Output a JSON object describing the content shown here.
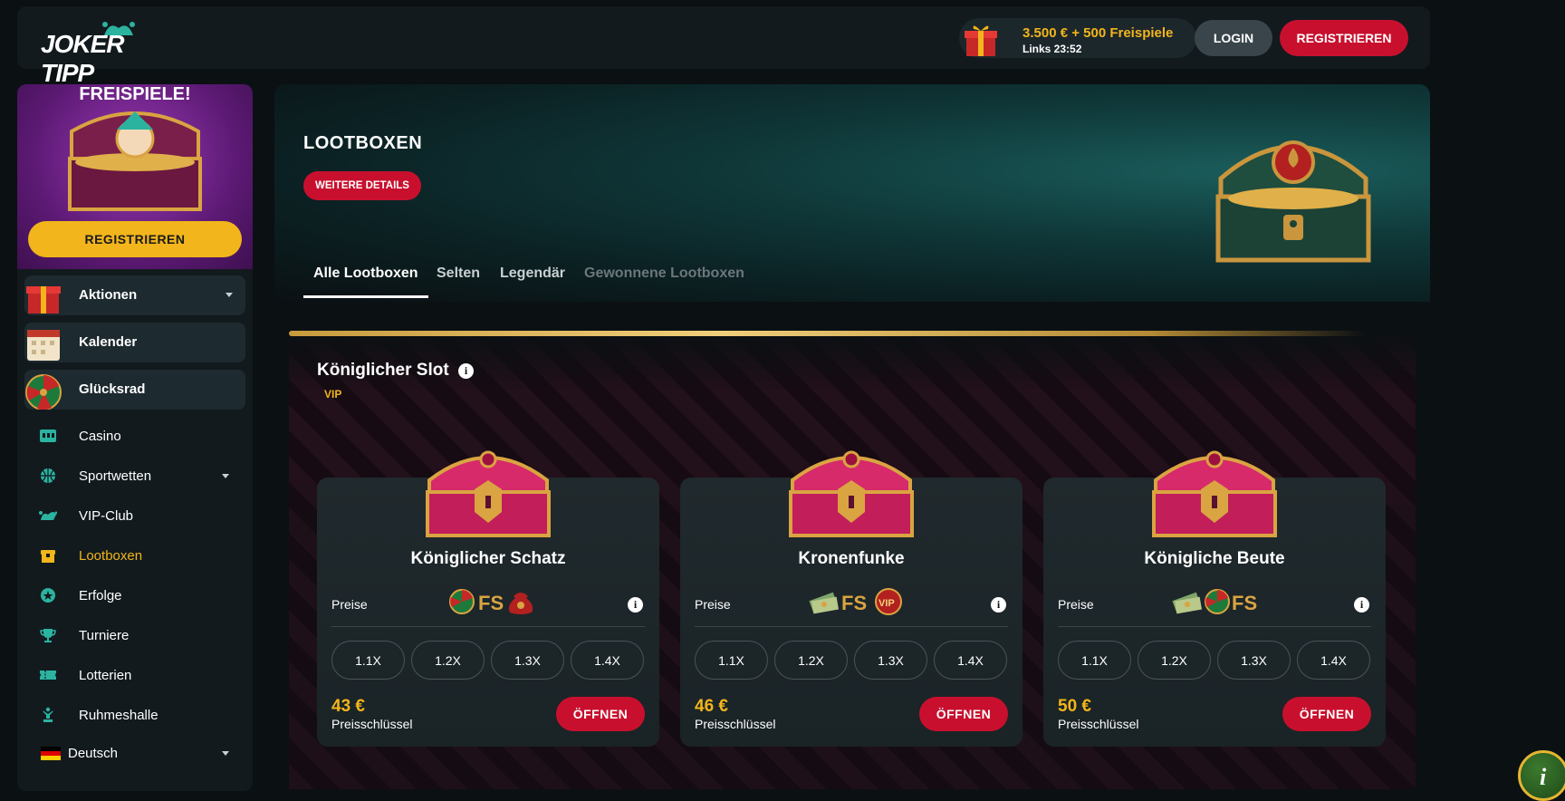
{
  "header": {
    "logo_text": "JOKER TIPP",
    "bonus_title": "3.500 € + 500 Freispiele",
    "bonus_timer": "Links 23:52",
    "login_label": "LOGIN",
    "register_label": "REGISTRIEREN"
  },
  "sidebar": {
    "promo_title": "FREISPIELE!",
    "promo_button": "REGISTRIEREN",
    "featured": [
      {
        "label": "Aktionen",
        "icon": "gift-icon"
      },
      {
        "label": "Kalender",
        "icon": "calendar-icon"
      },
      {
        "label": "Glücksrad",
        "icon": "wheel-icon"
      }
    ],
    "items": [
      {
        "label": "Casino",
        "icon": "slot-machine-icon"
      },
      {
        "label": "Sportwetten",
        "icon": "basketball-icon"
      },
      {
        "label": "VIP-Club",
        "icon": "jester-hat-icon"
      },
      {
        "label": "Lootboxen",
        "icon": "lootbox-icon"
      },
      {
        "label": "Erfolge",
        "icon": "star-badge-icon"
      },
      {
        "label": "Turniere",
        "icon": "trophy-icon"
      },
      {
        "label": "Lotterien",
        "icon": "ticket-icon"
      },
      {
        "label": "Ruhmeshalle",
        "icon": "statue-icon"
      }
    ],
    "language": "Deutsch"
  },
  "hero": {
    "title": "LOOTBOXEN",
    "details_button": "WEITERE DETAILS"
  },
  "tabs": [
    {
      "label": "Alle Lootboxen",
      "state": "active"
    },
    {
      "label": "Selten",
      "state": "normal"
    },
    {
      "label": "Legendär",
      "state": "normal"
    },
    {
      "label": "Gewonnene Lootboxen",
      "state": "disabled"
    }
  ],
  "section": {
    "title": "Königlicher Slot",
    "tag": "VIP"
  },
  "cards": [
    {
      "title": "Königlicher Schatz",
      "preise_label": "Preise",
      "prize_icons": [
        "wheel-icon",
        "fs-icon",
        "sack-icon"
      ],
      "multipliers": [
        "1.1X",
        "1.2X",
        "1.3X",
        "1.4X"
      ],
      "price": "43 €",
      "price_label": "Preisschlüssel",
      "open_label": "ÖFFNEN"
    },
    {
      "title": "Kronenfunke",
      "preise_label": "Preise",
      "prize_icons": [
        "cash-icon",
        "fs-icon",
        "vip-icon"
      ],
      "multipliers": [
        "1.1X",
        "1.2X",
        "1.3X",
        "1.4X"
      ],
      "price": "46 €",
      "price_label": "Preisschlüssel",
      "open_label": "ÖFFNEN"
    },
    {
      "title": "Königliche Beute",
      "preise_label": "Preise",
      "prize_icons": [
        "cash-icon",
        "wheel-icon",
        "fs-icon"
      ],
      "multipliers": [
        "1.1X",
        "1.2X",
        "1.3X",
        "1.4X"
      ],
      "price": "50 €",
      "price_label": "Preisschlüssel",
      "open_label": "ÖFFNEN"
    }
  ],
  "colors": {
    "accent_gold": "#f2b51b",
    "accent_red": "#c8102e",
    "panel": "#121a1e"
  }
}
